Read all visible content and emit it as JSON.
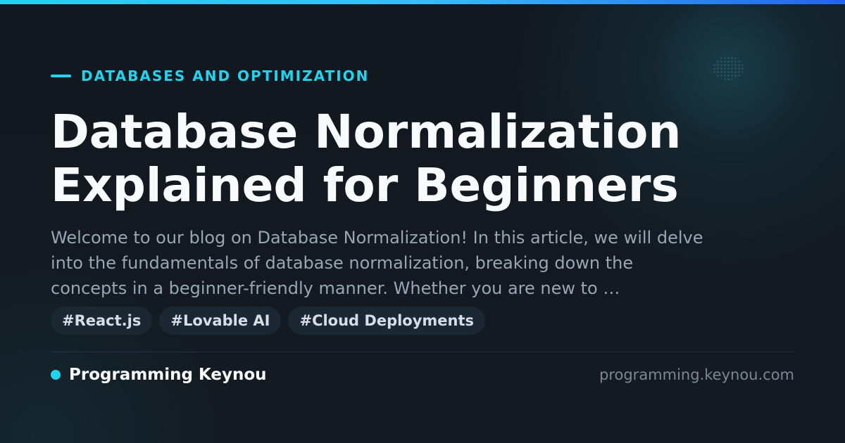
{
  "theme": {
    "background": "#121820",
    "accent": "#22d3ee",
    "accent_gradient_end": "#2563eb",
    "title_color": "#f8fafc",
    "text_muted": "#9aa5b4",
    "tag_background": "#1c2734"
  },
  "category": "DATABASES AND OPTIMIZATION",
  "title_lines": [
    "Database Normalization",
    "Explained for Beginners"
  ],
  "excerpt_lines": [
    "Welcome to our blog on Database Normalization! In this article, we will delve",
    "into the fundamentals of database normalization, breaking down the",
    "concepts in a beginner-friendly manner. Whether you are new to …"
  ],
  "tags": [
    "#React.js",
    "#Lovable AI",
    "#Cloud Deployments"
  ],
  "brand": {
    "name": "Programming Keynou",
    "url": "programming.keynou.com"
  }
}
